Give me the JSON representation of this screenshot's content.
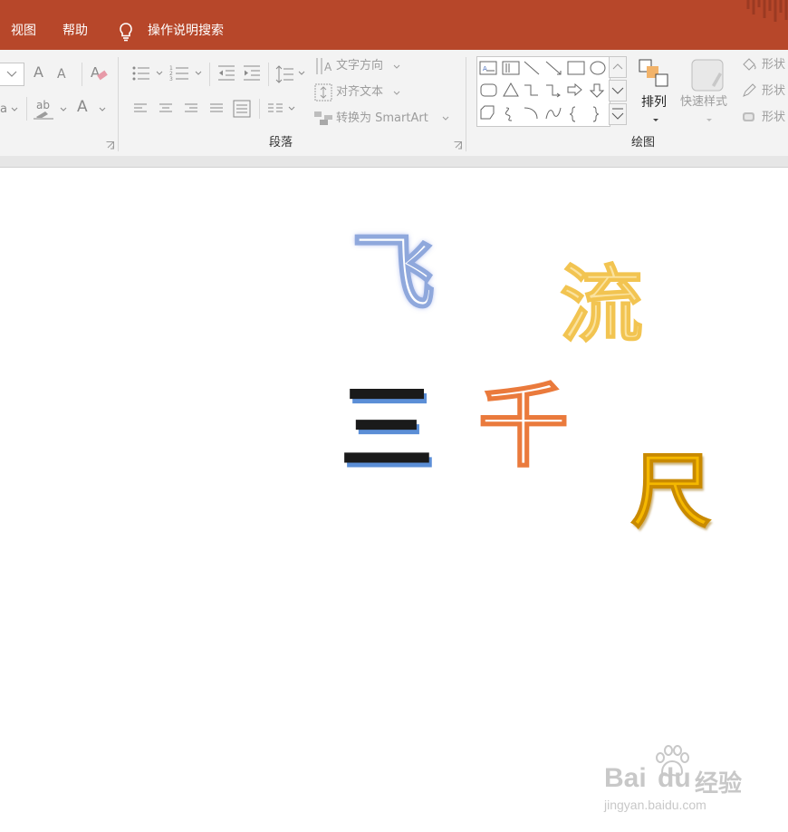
{
  "tabs": [
    {
      "label": "视图"
    },
    {
      "label": "帮助"
    }
  ],
  "tell_me": {
    "label": "操作说明搜索",
    "icon": "lightbulb-icon"
  },
  "ribbon": {
    "font": {
      "grow_glyph": "A",
      "shrink_glyph": "A",
      "font_color_glyph": "A",
      "case_fragment": "a",
      "highlight_glyph": "ab"
    },
    "paragraph": {
      "label": "段落",
      "text_direction": "文字方向",
      "align_text": "对齐文本",
      "convert_smartart": "转换为 SmartArt"
    },
    "drawing": {
      "label": "绘图",
      "arrange": "排列",
      "quick_styles": "快速样式",
      "shape_fill": "形状",
      "shape_outline": "形状",
      "shape_effects": "形状"
    }
  },
  "slide": {
    "wordart": [
      {
        "text": "飞",
        "style": "white fill, blue glow"
      },
      {
        "text": "流",
        "style": "light gold fill"
      },
      {
        "text": "三",
        "style": "black fill, blue shadow"
      },
      {
        "text": "千",
        "style": "white fill, orange outline"
      },
      {
        "text": "尺",
        "style": "gold gradient"
      }
    ]
  },
  "watermark": {
    "brand": "Bai",
    "brand2": "du",
    "brand_cn": "经验",
    "url": "jingyan.baidu.com"
  },
  "colors": {
    "title_bar": "#b7472a",
    "ribbon_bg": "#f3f3f3",
    "ribbon_text": "#8a8a8a"
  }
}
